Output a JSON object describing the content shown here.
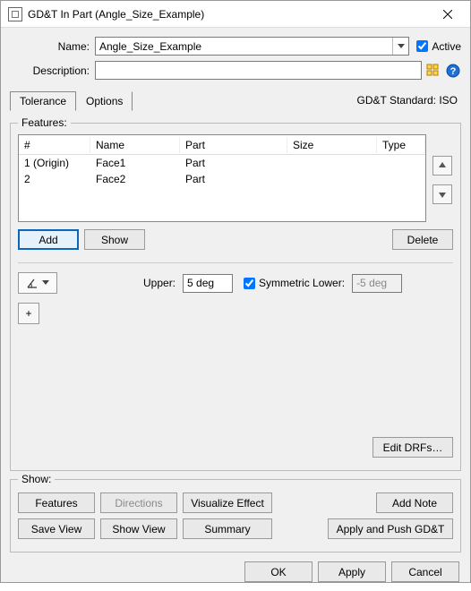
{
  "window": {
    "title": "GD&T In Part (Angle_Size_Example)"
  },
  "form": {
    "name_label": "Name:",
    "name_value": "Angle_Size_Example",
    "active_label": "Active",
    "active_checked": true,
    "desc_label": "Description:",
    "desc_value": ""
  },
  "tabs": {
    "tolerance": "Tolerance",
    "options": "Options"
  },
  "standard_label": "GD&T Standard: ISO",
  "features": {
    "legend": "Features:",
    "columns": {
      "num": "#",
      "name": "Name",
      "part": "Part",
      "size": "Size",
      "type": "Type"
    },
    "rows": [
      {
        "num": "1 (Origin)",
        "name": "Face1",
        "part": "Part",
        "size": "",
        "type": ""
      },
      {
        "num": "2",
        "name": "Face2",
        "part": "Part",
        "size": "",
        "type": ""
      }
    ],
    "buttons": {
      "add": "Add",
      "show": "Show",
      "delete": "Delete"
    }
  },
  "tolerance_spec": {
    "upper_label": "Upper:",
    "upper_value": "5 deg",
    "symmetric_label": "Symmetric Lower:",
    "symmetric_checked": true,
    "lower_value": "-5 deg",
    "plus": "+"
  },
  "edit_drfs": "Edit DRFs…",
  "show": {
    "legend": "Show:",
    "features": "Features",
    "directions": "Directions",
    "visualize": "Visualize Effect",
    "add_note": "Add Note",
    "save_view": "Save View",
    "show_view": "Show View",
    "summary": "Summary",
    "apply_push": "Apply and Push GD&T"
  },
  "footer": {
    "ok": "OK",
    "apply": "Apply",
    "cancel": "Cancel"
  }
}
